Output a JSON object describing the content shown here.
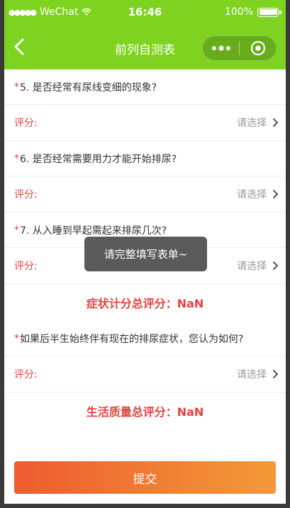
{
  "status_bar": {
    "signal": "●●●●●",
    "carrier": "WeChat",
    "time": "16:46",
    "battery_percent": "100%"
  },
  "nav": {
    "title": "前列自测表"
  },
  "form": {
    "q5": {
      "star": "*",
      "text": "5. 是否经常有尿线变细的现象?"
    },
    "q6": {
      "star": "*",
      "text": "6. 是否经常需要用力才能开始排尿?"
    },
    "q7": {
      "star": "*",
      "text": "7. 从入睡到早起需起来排尿几次?"
    },
    "score_label": "评分:",
    "picker_placeholder": "请选择",
    "symptom_total": "症状计分总评分：NaN",
    "q_life": {
      "star": "*",
      "text": "如果后半生始终伴有现在的排尿症状，您认为如何?"
    },
    "quality_total": "生活质量总评分：NaN",
    "submit_label": "提交"
  },
  "toast": {
    "message": "请完整填写表单~"
  },
  "colors": {
    "brand": "#7ed321",
    "required": "#e64340",
    "button_start": "#ee5b2f",
    "button_end": "#f39a38"
  }
}
